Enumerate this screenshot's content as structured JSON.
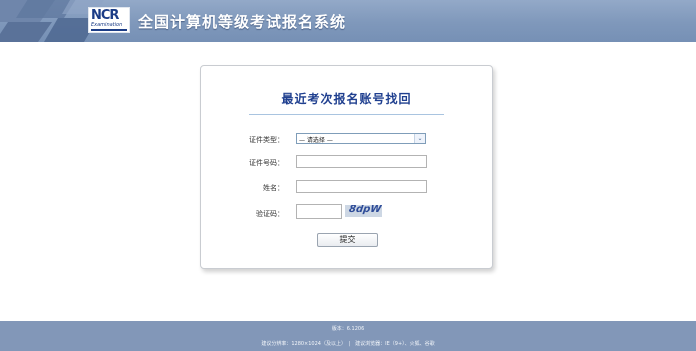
{
  "header": {
    "logo_text": "NCR",
    "logo_sub": "Examination",
    "title": "全国计算机等级考试报名系统"
  },
  "form": {
    "title": "最近考次报名账号找回",
    "id_type_label": "证件类型：",
    "id_type_value": "— 请选择 —",
    "id_number_label": "证件号码：",
    "name_label": "姓名：",
    "captcha_label": "验证码：",
    "captcha_text": "8dpW",
    "submit_label": "提交"
  },
  "footer": {
    "version": "版本：6.1206",
    "recommend": "建议分辨率：1280×1024（及以上）　|　建议浏览器：IE（9+）、火狐、谷歌"
  },
  "colors": {
    "header_bg": "#7f98bb",
    "footer_bg": "#8297b8",
    "title_color": "#1f3f8f"
  },
  "icons": {
    "select_arrow": "chevron-down-icon"
  }
}
